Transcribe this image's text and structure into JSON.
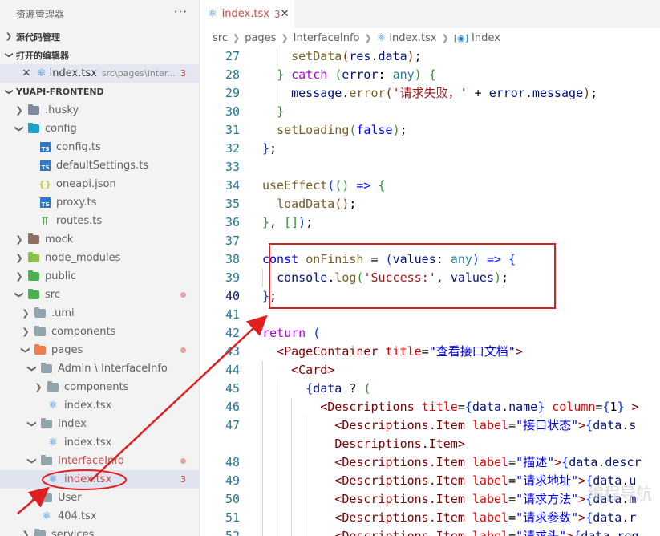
{
  "sidebar": {
    "title": "资源管理器",
    "more": "···",
    "source_control": "源代码管理",
    "open_editors": "打开的编辑器",
    "open_editor_item": {
      "name": "index.tsx",
      "path": "src\\pages\\Inter...",
      "badge": "3"
    },
    "project": "YUAPI-FRONTEND",
    "tree": [
      {
        "label": ".husky"
      },
      {
        "label": "config"
      },
      {
        "label": "config.ts"
      },
      {
        "label": "defaultSettings.ts"
      },
      {
        "label": "oneapi.json"
      },
      {
        "label": "proxy.ts"
      },
      {
        "label": "routes.ts"
      },
      {
        "label": "mock"
      },
      {
        "label": "node_modules"
      },
      {
        "label": "public"
      },
      {
        "label": "src"
      },
      {
        "label": ".umi"
      },
      {
        "label": "components"
      },
      {
        "label": "pages"
      },
      {
        "label": "Admin \\ InterfaceInfo"
      },
      {
        "label": "components"
      },
      {
        "label": "index.tsx"
      },
      {
        "label": "Index"
      },
      {
        "label": "index.tsx"
      },
      {
        "label": "InterfaceInfo"
      },
      {
        "label": "index.tsx",
        "badge": "3"
      },
      {
        "label": "User"
      },
      {
        "label": "404.tsx"
      },
      {
        "label": "services"
      }
    ]
  },
  "editor": {
    "tab": {
      "name": "index.tsx",
      "badge": "3",
      "close": "✕"
    },
    "breadcrumb": [
      "src",
      "pages",
      "InterfaceInfo",
      "index.tsx",
      "Index"
    ],
    "line_numbers": [
      "27",
      "28",
      "29",
      "30",
      "31",
      "32",
      "33",
      "34",
      "35",
      "36",
      "37",
      "38",
      "39",
      "40",
      "41",
      "42",
      "43",
      "44",
      "45",
      "46",
      "47",
      "",
      "48",
      "49",
      "50",
      "51",
      "52"
    ],
    "current_line": "40"
  },
  "watermark": "编程导航"
}
